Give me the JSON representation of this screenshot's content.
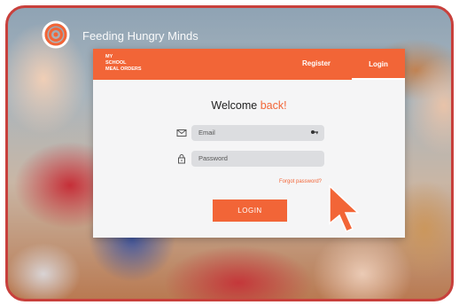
{
  "brand": {
    "name": "Feeding Hungry Minds",
    "accent_color": "#f26537",
    "frame_color": "#c8403c"
  },
  "header": {
    "logo_line1": "MY",
    "logo_line2": "SCHOOL",
    "logo_line3": "MEAL ORDERS",
    "nav": {
      "register": "Register",
      "login": "Login"
    }
  },
  "form": {
    "welcome_word": "Welcome",
    "welcome_accent": "back!",
    "email_placeholder": "Email",
    "password_placeholder": "Password",
    "forgot_label": "Forgot password?",
    "login_button": "LOGIN",
    "email_icon": "envelope-icon",
    "password_icon": "lock-icon",
    "autofill_icon": "key-icon"
  },
  "overlay": {
    "cursor_icon": "pointer-arrow-icon"
  }
}
